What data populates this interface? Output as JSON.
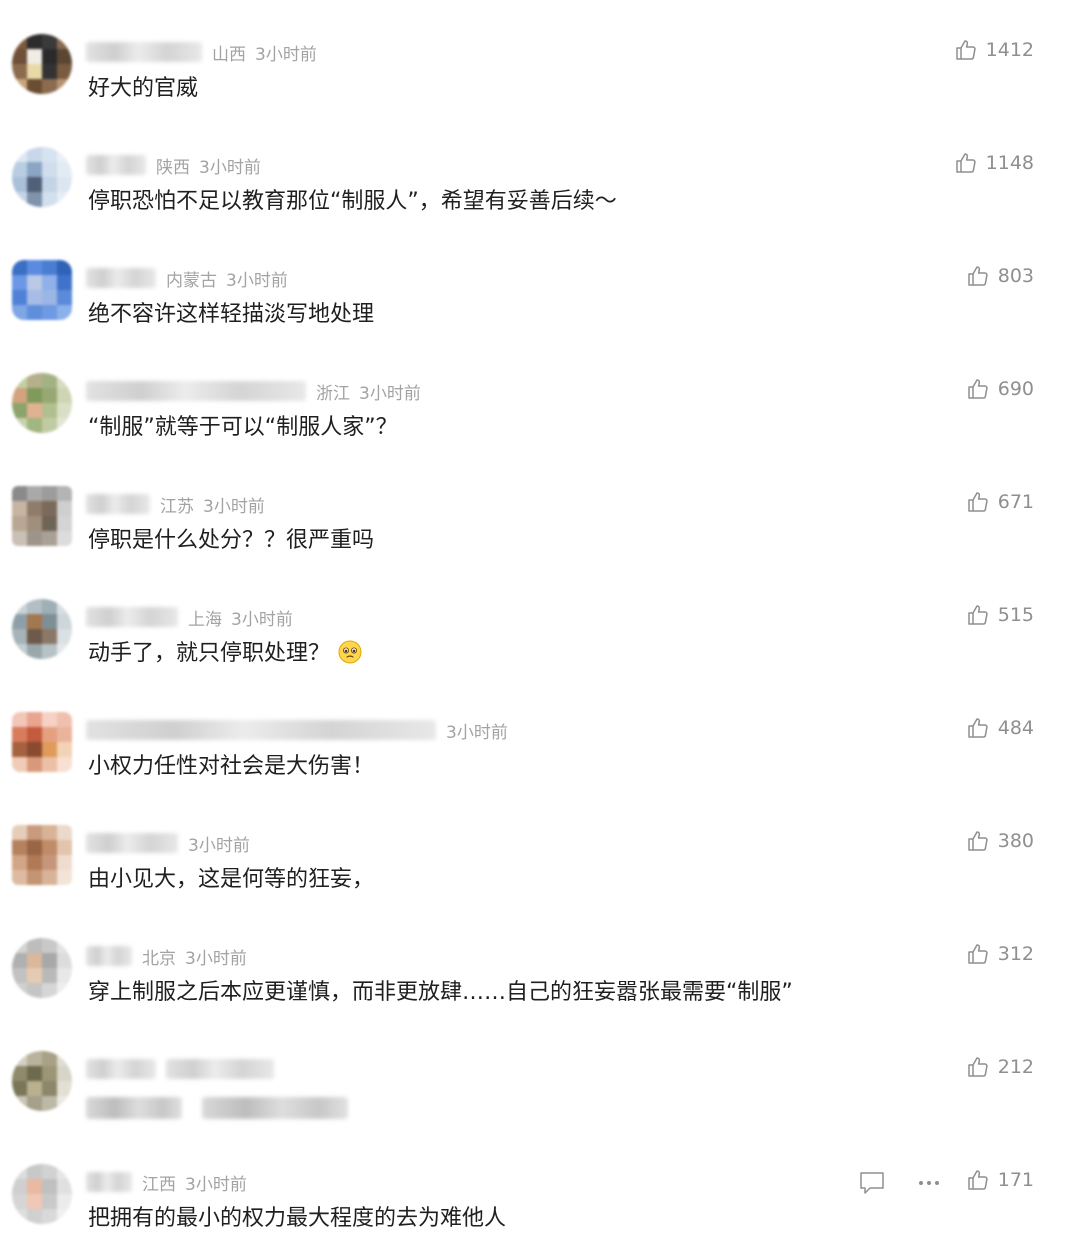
{
  "comments": [
    {
      "location": "山西",
      "time": "3小时前",
      "content": "好大的官威",
      "likes": "1412"
    },
    {
      "location": "陕西",
      "time": "3小时前",
      "content": "停职恐怕不足以教育那位“制服人”，希望有妥善后续～",
      "likes": "1148"
    },
    {
      "location": "内蒙古",
      "time": "3小时前",
      "content": "绝不容许这样轻描淡写地处理",
      "likes": "803"
    },
    {
      "location": "浙江",
      "time": "3小时前",
      "content": "“制服”就等于可以“制服人家”？",
      "likes": "690"
    },
    {
      "location": "江苏",
      "time": "3小时前",
      "content": "停职是什么处分？？很严重吗",
      "likes": "671"
    },
    {
      "location": "上海",
      "time": "3小时前",
      "content": "动手了，就只停职处理？",
      "likes": "515"
    },
    {
      "location": "",
      "time": "3小时前",
      "content": "小权力任性对社会是大伤害！",
      "likes": "484"
    },
    {
      "location": "",
      "time": "3小时前",
      "content": "由小见大，这是何等的狂妄，",
      "likes": "380"
    },
    {
      "location": "北京",
      "time": "3小时前",
      "content": "穿上制服之后本应更谨慎，而非更放肆……自己的狂妄嚣张最需要“制服”",
      "likes": "312"
    },
    {
      "location": "",
      "time": "",
      "content": "",
      "likes": "212"
    },
    {
      "location": "江西",
      "time": "3小时前",
      "content": "把拥有的最小的权力最大程度的去为难他人",
      "likes": "171"
    }
  ],
  "icons": {
    "like": "thumbs-up-icon",
    "reply": "comment-icon",
    "more": "more-icon",
    "emoji": "pleading-face-emoji"
  },
  "colors": {
    "text": "#1f1f1f",
    "meta": "#a3a3a3",
    "like": "#8f8f8f",
    "background": "#ffffff"
  }
}
